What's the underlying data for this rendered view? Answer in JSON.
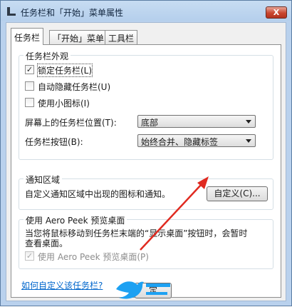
{
  "window": {
    "title": "任务栏和「开始」菜单属性",
    "close_symbol": "X"
  },
  "tabs": [
    {
      "label": "任务栏",
      "active": true
    },
    {
      "label": "「开始」菜单",
      "active": false
    },
    {
      "label": "工具栏",
      "active": false
    }
  ],
  "appearance": {
    "title": "任务栏外观",
    "lock_label": "锁定任务栏(L)",
    "lock_checked": true,
    "autohide_label": "自动隐藏任务栏(U)",
    "autohide_checked": false,
    "small_icons_label": "使用小图标(I)",
    "small_icons_checked": false,
    "position_label": "屏幕上的任务栏位置(T):",
    "position_value": "底部",
    "buttons_label": "任务栏按钮(B):",
    "buttons_value": "始终合并、隐藏标签"
  },
  "notification": {
    "title": "通知区域",
    "description": "自定义通知区域中出现的图标和通知。",
    "customize_button": "自定义(C)..."
  },
  "aero_peek": {
    "title": "使用 Aero Peek 预览桌面",
    "description_line1": "当您将鼠标移动到任务栏末端的“显示桌面”按钮时，会暂时",
    "description_line2": "查看桌面。",
    "checkbox_label": "使用 Aero Peek 预览桌面(P)",
    "checkbox_checked": true
  },
  "help_link": "如何自定义该任务栏?",
  "ok_button": {
    "label": "定"
  },
  "check_mark": "✓",
  "colors": {
    "arrow": "#e02a20",
    "link": "#0066cc",
    "logo_blue": "#1da1f2"
  }
}
